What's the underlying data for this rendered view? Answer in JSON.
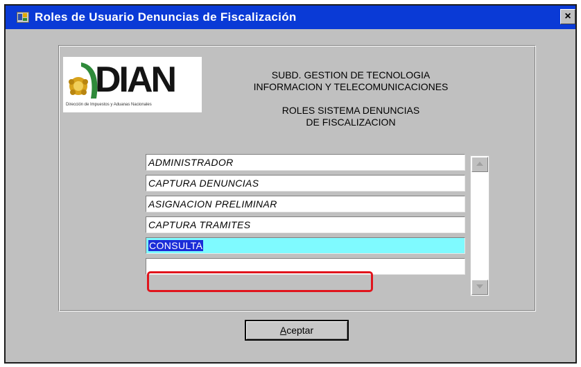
{
  "window": {
    "title": "Roles  de Usuario  Denuncias  de Fiscalización",
    "close_label": "×",
    "title_icon": "app-icon"
  },
  "logo": {
    "wordmark": "DIAN",
    "caption": "Dirección de Impuestos y Aduanas Nacionales"
  },
  "header": {
    "line1": "SUBD. GESTION DE TECNOLOGIA",
    "line2": "INFORMACION Y TELECOMUNICACIONES",
    "line3": "ROLES SISTEMA DENUNCIAS",
    "line4": "DE FISCALIZACION"
  },
  "roles": {
    "items": [
      {
        "label": "ADMINISTRADOR"
      },
      {
        "label": "CAPTURA DENUNCIAS"
      },
      {
        "label": "ASIGNACION PRELIMINAR"
      },
      {
        "label": "CAPTURA TRAMITES"
      },
      {
        "label": "CONSULTA"
      },
      {
        "label": ""
      }
    ],
    "selected_index": 4
  },
  "buttons": {
    "accept_first": "A",
    "accept_rest": "ceptar"
  },
  "colors": {
    "titlebar": "#0a3ad6",
    "selected_row": "#7ffaff",
    "selected_text_bg": "#1b2cd8",
    "highlight_border": "#e0141c",
    "window_bg": "#c0c0c0"
  }
}
